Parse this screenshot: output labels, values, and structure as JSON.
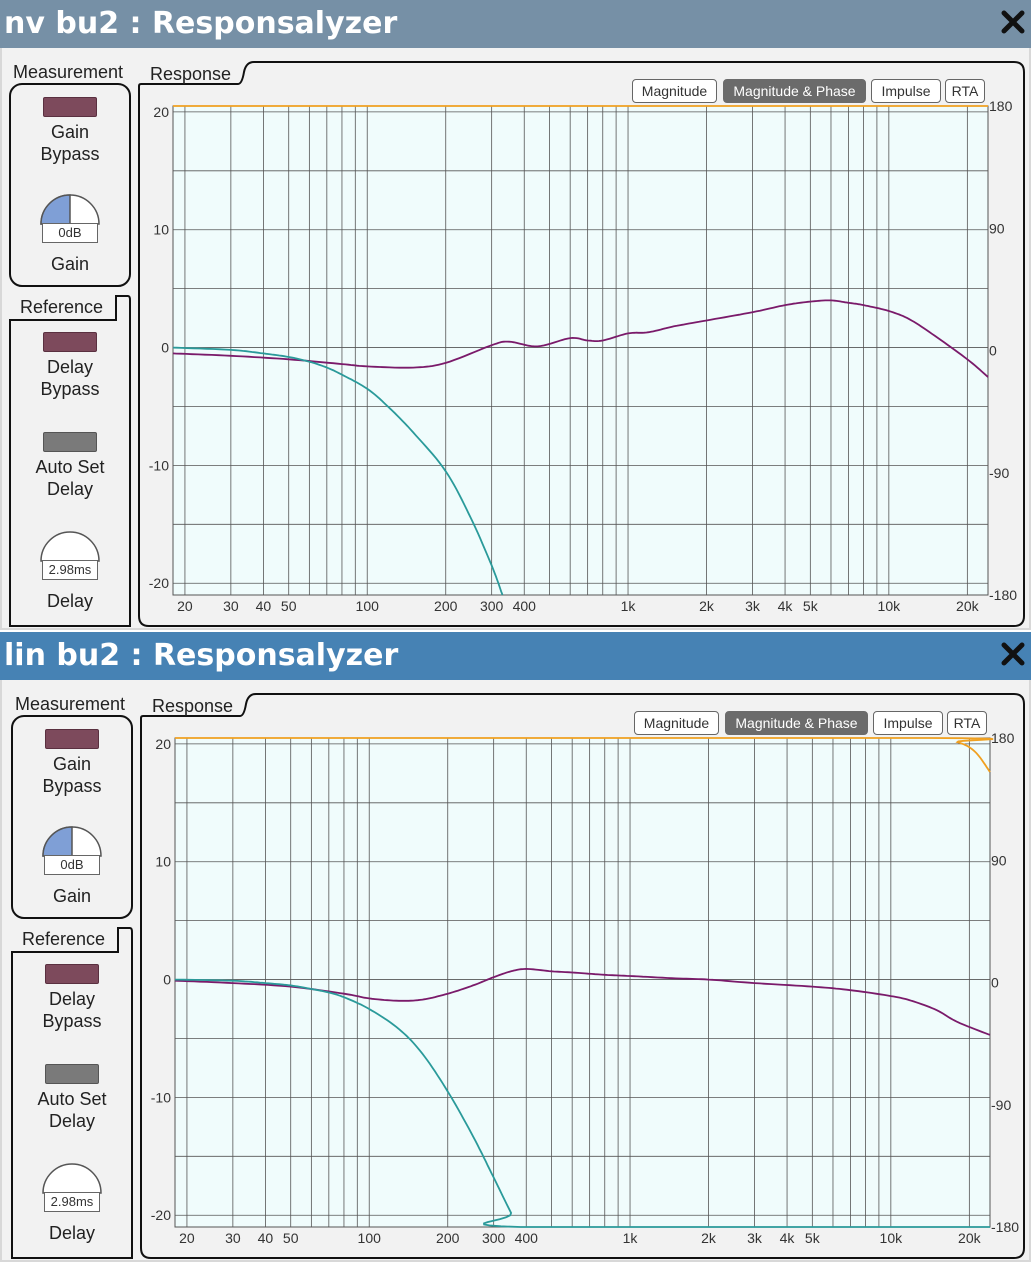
{
  "colors": {
    "title_bg_1": "#7690a6",
    "title_bg_2": "#4682b4",
    "plot_bg": "#f0fcfc",
    "magnitude": "#7a1a6a",
    "filter": "#2a9a9a",
    "phase": "#f0a020"
  },
  "icons": {
    "close": "close-icon",
    "gain_knob": "knob-icon"
  },
  "panels": [
    {
      "title": "nv bu2 : Responsalyzer",
      "measurement": {
        "label": "Measurement",
        "gain_bypass_label": "Gain\nBypass",
        "gain_value": "0dB",
        "gain_label": "Gain",
        "gain_knob_fraction": 0.5
      },
      "reference": {
        "label": "Reference",
        "delay_bypass_label": "Delay\nBypass",
        "auto_set_label": "Auto Set\nDelay",
        "delay_value": "2.98ms",
        "delay_label": "Delay",
        "delay_knob_fraction": 0.0
      },
      "response_label": "Response",
      "tabs": [
        "Magnitude",
        "Magnitude & Phase",
        "Impulse",
        "RTA"
      ],
      "active_tab": "Magnitude & Phase"
    },
    {
      "title": "lin bu2 : Responsalyzer",
      "measurement": {
        "label": "Measurement",
        "gain_bypass_label": "Gain\nBypass",
        "gain_value": "0dB",
        "gain_label": "Gain",
        "gain_knob_fraction": 0.5
      },
      "reference": {
        "label": "Reference",
        "delay_bypass_label": "Delay\nBypass",
        "auto_set_label": "Auto Set\nDelay",
        "delay_value": "2.98ms",
        "delay_label": "Delay",
        "delay_knob_fraction": 0.0
      },
      "response_label": "Response",
      "tabs": [
        "Magnitude",
        "Magnitude & Phase",
        "Impulse",
        "RTA"
      ],
      "active_tab": "Magnitude & Phase"
    }
  ],
  "chart_data": [
    {
      "type": "line",
      "xscale": "log",
      "xlim": [
        18,
        24000
      ],
      "ylim": [
        -21,
        20.5
      ],
      "ylim_right": [
        -180,
        180
      ],
      "y_ticks": [
        "20",
        "10",
        "0",
        "-10",
        "-20"
      ],
      "y_tick_values": [
        20,
        10,
        0,
        -10,
        -20
      ],
      "y_right_ticks": [
        "180",
        "90",
        "0",
        "-90",
        "-180"
      ],
      "y_right_tick_values": [
        180,
        90,
        0,
        -90,
        -180
      ],
      "x_ticks": [
        "20",
        "30",
        "40",
        "50",
        "100",
        "200",
        "300",
        "400",
        "1k",
        "2k",
        "3k",
        "4k",
        "5k",
        "10k",
        "20k"
      ],
      "x_tick_values": [
        20,
        30,
        40,
        50,
        100,
        200,
        300,
        400,
        1000,
        2000,
        3000,
        4000,
        5000,
        10000,
        20000
      ],
      "grid": true,
      "series": [
        {
          "key": "magnitude",
          "x": [
            18,
            30,
            50,
            80,
            100,
            150,
            200,
            300,
            350,
            450,
            600,
            700,
            800,
            1000,
            1200,
            1500,
            2000,
            3000,
            4000,
            5000,
            6000,
            7000,
            8000,
            10000,
            12000,
            15000,
            20000,
            24000
          ],
          "y": [
            -0.5,
            -0.7,
            -1.0,
            -1.4,
            -1.6,
            -1.7,
            -1.3,
            0.2,
            0.5,
            0.1,
            0.8,
            0.6,
            0.6,
            1.2,
            1.3,
            1.8,
            2.3,
            3.0,
            3.6,
            3.9,
            4.0,
            3.8,
            3.6,
            3.1,
            2.4,
            1.0,
            -1.0,
            -2.5
          ]
        },
        {
          "key": "filter",
          "x": [
            18,
            30,
            40,
            50,
            60,
            70,
            80,
            100,
            120,
            150,
            200,
            250,
            300,
            330
          ],
          "y": [
            0.0,
            -0.2,
            -0.5,
            -0.8,
            -1.2,
            -1.7,
            -2.3,
            -3.5,
            -5.0,
            -7.2,
            -10.5,
            -14.5,
            -18.5,
            -21
          ]
        },
        {
          "key": "phase",
          "x": [
            18,
            24000
          ],
          "y": [
            180,
            180
          ]
        }
      ]
    },
    {
      "type": "line",
      "xscale": "log",
      "xlim": [
        18,
        24000
      ],
      "ylim": [
        -21,
        20.5
      ],
      "ylim_right": [
        -180,
        180
      ],
      "y_ticks": [
        "20",
        "10",
        "0",
        "-10",
        "-20"
      ],
      "y_tick_values": [
        20,
        10,
        0,
        -10,
        -20
      ],
      "y_right_ticks": [
        "180",
        "90",
        "0",
        "-90",
        "-180"
      ],
      "y_right_tick_values": [
        180,
        90,
        0,
        -90,
        -180
      ],
      "x_ticks": [
        "20",
        "30",
        "40",
        "50",
        "100",
        "200",
        "300",
        "400",
        "1k",
        "2k",
        "3k",
        "4k",
        "5k",
        "10k",
        "20k"
      ],
      "x_tick_values": [
        20,
        30,
        40,
        50,
        100,
        200,
        300,
        400,
        1000,
        2000,
        3000,
        4000,
        5000,
        10000,
        20000
      ],
      "grid": true,
      "series": [
        {
          "key": "magnitude",
          "x": [
            18,
            30,
            50,
            80,
            100,
            130,
            160,
            200,
            250,
            300,
            350,
            400,
            500,
            600,
            800,
            1000,
            1500,
            2000,
            3000,
            5000,
            7000,
            10000,
            12000,
            15000,
            18000,
            24000
          ],
          "y": [
            -0.1,
            -0.3,
            -0.6,
            -1.2,
            -1.6,
            -1.8,
            -1.7,
            -1.2,
            -0.5,
            0.2,
            0.7,
            0.9,
            0.7,
            0.6,
            0.4,
            0.3,
            0.1,
            0.0,
            -0.3,
            -0.6,
            -0.9,
            -1.4,
            -1.8,
            -2.6,
            -3.6,
            -4.7
          ]
        },
        {
          "key": "filter",
          "x": [
            18,
            30,
            40,
            50,
            60,
            70,
            80,
            100,
            130,
            160,
            200,
            250,
            300,
            350,
            380,
            24000
          ],
          "y": [
            0.0,
            -0.1,
            -0.3,
            -0.5,
            -0.8,
            -1.1,
            -1.5,
            -2.5,
            -4.2,
            -6.3,
            -9.5,
            -13.3,
            -16.8,
            -19.8,
            -21,
            -21
          ]
        },
        {
          "key": "phase",
          "x": [
            18,
            14000,
            18000,
            21000,
            24000
          ],
          "y": [
            180,
            180,
            177,
            170,
            155
          ]
        }
      ]
    }
  ]
}
